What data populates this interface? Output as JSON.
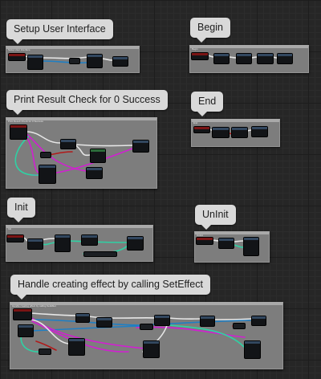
{
  "comments": {
    "setup": {
      "bubble": "Setup User Interface",
      "header": "Setup User Interface"
    },
    "begin": {
      "bubble": "Begin",
      "header": "Begin"
    },
    "print": {
      "bubble": "Print Result Check for 0 Success",
      "header": "Print Result Check for 0 Success"
    },
    "end": {
      "bubble": "End",
      "header": "End"
    },
    "init": {
      "bubble": "Init",
      "header": "Init"
    },
    "uninit": {
      "bubble": "UnInit",
      "header": "UnInit"
    },
    "effect": {
      "bubble": "Handle creating effect by calling SetEffect",
      "header": "Handle creating effect by calling SetEffect"
    }
  },
  "colors": {
    "exec": "#e6e6e6",
    "object": "#1f7fc4",
    "struct": "#d21fd2",
    "float": "#2fd1a4",
    "bool": "#8c1010",
    "comment_bg": "#7d7d7d",
    "graph_bg": "#262626"
  }
}
